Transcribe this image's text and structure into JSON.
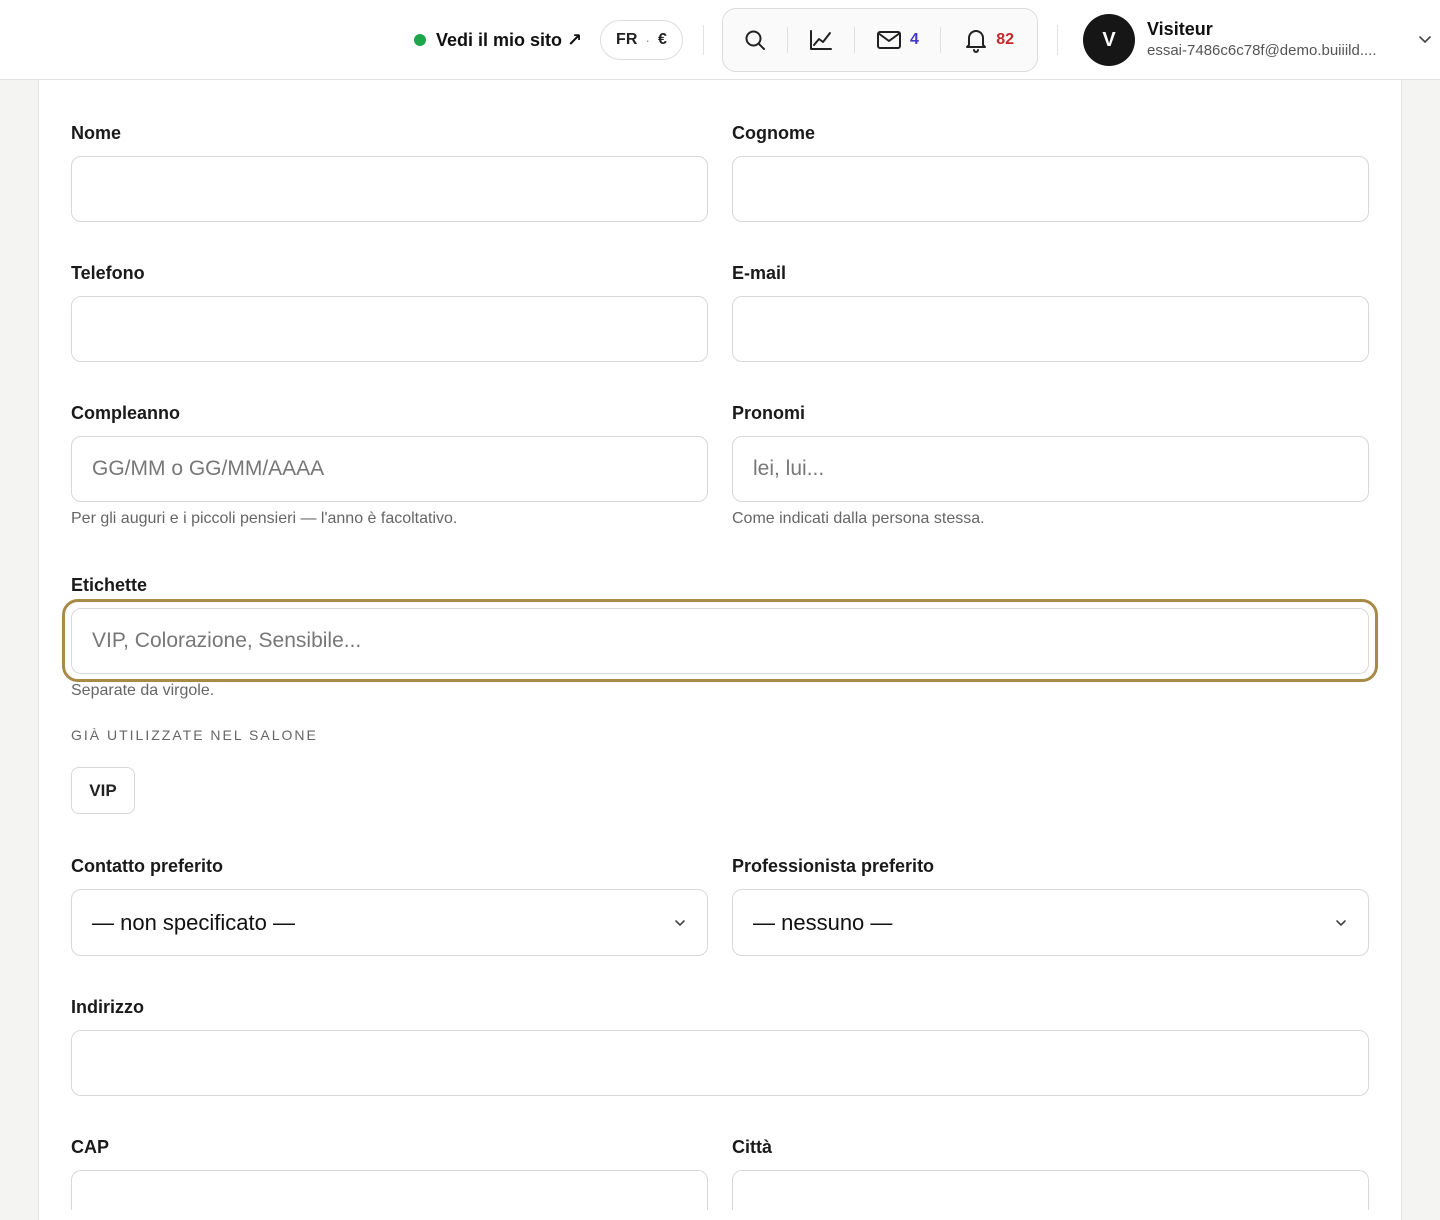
{
  "header": {
    "site_link_label": "Vedi il mio sito ↗",
    "locale": "FR",
    "locale_sep": "·",
    "currency": "€",
    "messages_count": "4",
    "notifications_count": "82",
    "user": {
      "avatar_letter": "V",
      "name": "Visiteur",
      "email": "essai-7486c6c78f@demo.buiiild...."
    },
    "icons": [
      "search-icon",
      "chart-icon",
      "mail-icon",
      "bell-icon",
      "chevron-down-icon"
    ],
    "colors": {
      "online": "#1fa64b",
      "messages": "#4338ca",
      "notifications": "#c62828",
      "focus_ring": "#a88a47"
    }
  },
  "form": {
    "nome": {
      "label": "Nome",
      "value": "",
      "placeholder": ""
    },
    "cognome": {
      "label": "Cognome",
      "value": "",
      "placeholder": ""
    },
    "telefono": {
      "label": "Telefono",
      "value": "",
      "placeholder": ""
    },
    "email": {
      "label": "E-mail",
      "value": "",
      "placeholder": ""
    },
    "compleanno": {
      "label": "Compleanno",
      "value": "",
      "placeholder": "GG/MM o GG/MM/AAAA",
      "help": "Per gli auguri e i piccoli pensieri — l'anno è facoltativo."
    },
    "pronomi": {
      "label": "Pronomi",
      "value": "",
      "placeholder": "lei, lui...",
      "help": "Come indicati dalla persona stessa."
    },
    "etichette": {
      "label": "Etichette",
      "value": "",
      "placeholder": "VIP, Colorazione, Sensibile...",
      "help": "Separate da virgole.",
      "used_heading": "GIÀ UTILIZZATE NEL SALONE",
      "used_tags": [
        "VIP"
      ]
    },
    "contatto_preferito": {
      "label": "Contatto preferito",
      "selected": "— non specificato —"
    },
    "professionista_preferito": {
      "label": "Professionista preferito",
      "selected": "— nessuno —"
    },
    "indirizzo": {
      "label": "Indirizzo",
      "value": "",
      "placeholder": ""
    },
    "cap": {
      "label": "CAP",
      "value": "",
      "placeholder": ""
    },
    "citta": {
      "label": "Città",
      "value": "",
      "placeholder": ""
    }
  }
}
